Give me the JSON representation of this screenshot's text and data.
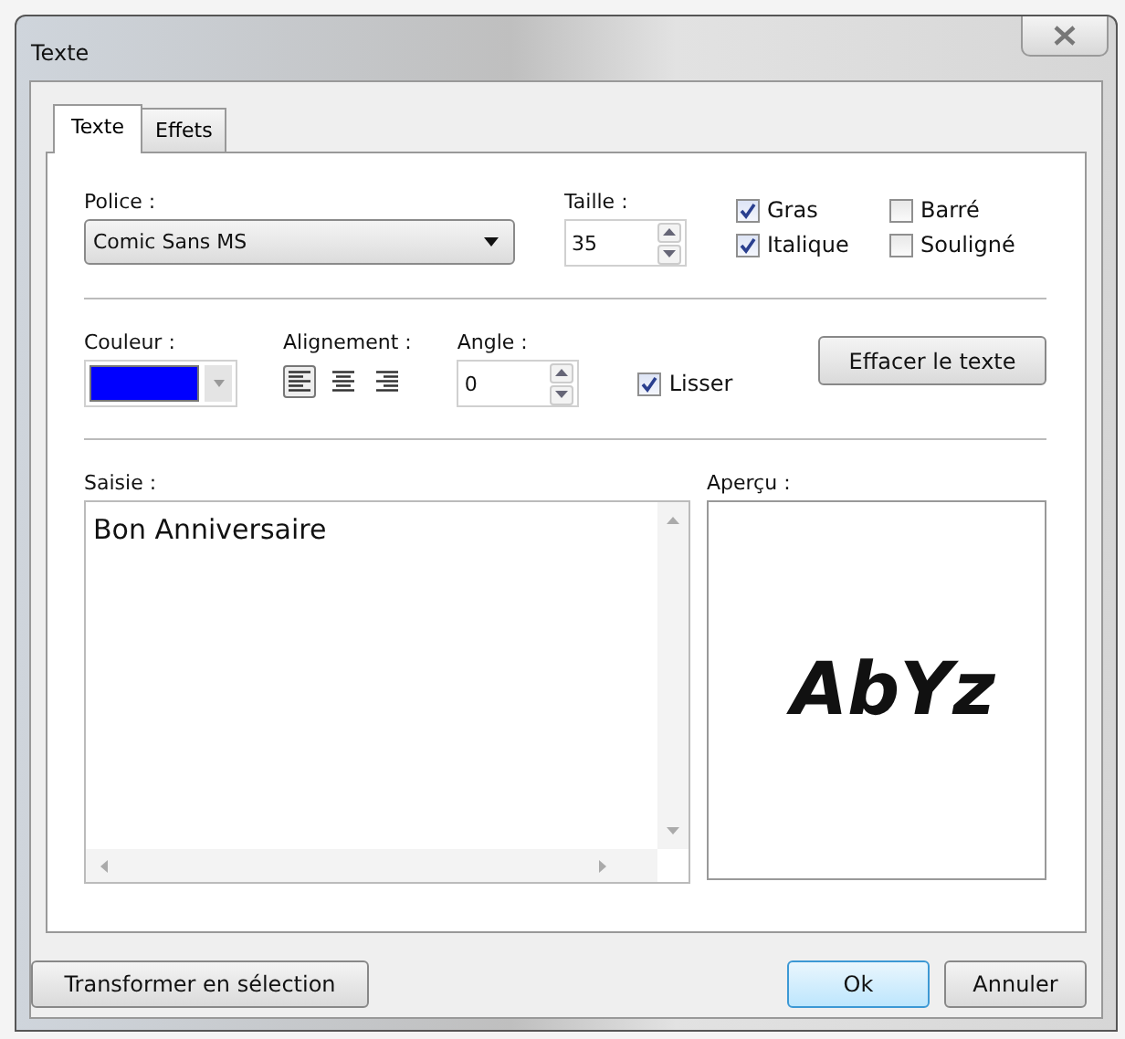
{
  "window": {
    "title": "Texte"
  },
  "tabs": [
    {
      "label": "Texte",
      "selected": true
    },
    {
      "label": "Effets",
      "selected": false
    }
  ],
  "font": {
    "label": "Police :",
    "value": "Comic Sans MS"
  },
  "size": {
    "label": "Taille :",
    "value": "35"
  },
  "styles": [
    {
      "label": "Gras",
      "checked": true
    },
    {
      "label": "Barré",
      "checked": false
    },
    {
      "label": "Italique",
      "checked": true
    },
    {
      "label": "Souligné",
      "checked": false
    }
  ],
  "colour": {
    "label": "Couleur :",
    "color": "#0000ff"
  },
  "alignment": {
    "label": "Alignement :",
    "options": [
      {
        "kind": "left",
        "selected": true
      },
      {
        "kind": "center",
        "selected": false
      },
      {
        "kind": "right",
        "selected": false
      }
    ]
  },
  "angle": {
    "label": "Angle :",
    "value": "0"
  },
  "smooth": {
    "label": "Lisser",
    "checked": true
  },
  "clear_button": "Effacer le texte",
  "input": {
    "label": "Saisie :",
    "value": "Bon Anniversaire"
  },
  "preview": {
    "label": "Aperçu :",
    "sample": "AbYz"
  },
  "buttons": [
    {
      "label": "Transformer en sélection",
      "default": false
    },
    {
      "label": "Ok",
      "default": true
    },
    {
      "label": "Annuler",
      "default": false
    }
  ]
}
